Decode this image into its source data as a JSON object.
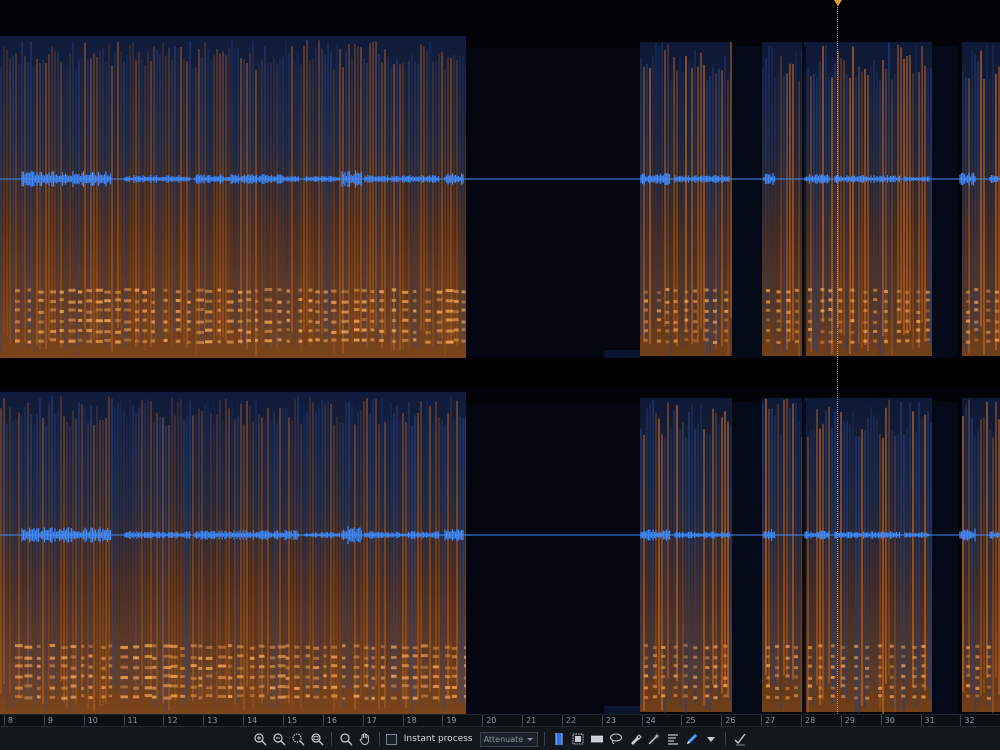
{
  "colors": {
    "background": "#000000",
    "spectrogram_low": "#0a1430",
    "spectrogram_mid": "#2c4f9a",
    "spectrogram_high": "#e07a2a",
    "spectrogram_peak": "#ffb05a",
    "waveform": "#3d8bff",
    "playhead": "#e6a03a"
  },
  "timeline": {
    "ticks": [
      "8",
      "9",
      "10",
      "11",
      "12",
      "13",
      "14",
      "15",
      "16",
      "17",
      "18",
      "19",
      "20",
      "21",
      "22",
      "23",
      "24",
      "25",
      "26",
      "27",
      "28",
      "29",
      "30",
      "31",
      "32"
    ]
  },
  "toolbar": {
    "instant_process_label": "Instant process",
    "mode_select_value": "Attenuate",
    "icons": [
      "zoom-in-icon",
      "zoom-out-icon",
      "zoom-selection-icon",
      "zoom-fit-icon",
      "magnify-icon",
      "hand-icon",
      "time-selection-icon",
      "rectangle-selection-icon",
      "frequency-selection-icon",
      "lasso-icon",
      "brush-icon",
      "magic-wand-icon",
      "harmonic-selection-icon",
      "pencil-icon",
      "dropdown-arrow-icon",
      "apply-check-icon"
    ]
  }
}
